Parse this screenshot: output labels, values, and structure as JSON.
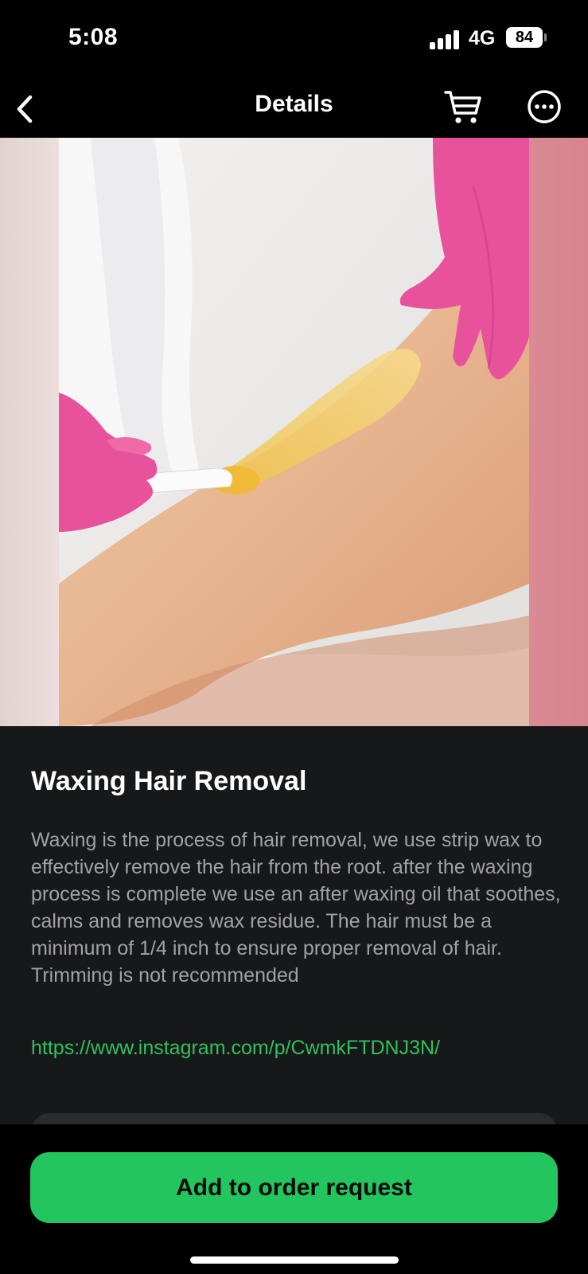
{
  "status_bar": {
    "time": "5:08",
    "network": "4G",
    "battery": "84"
  },
  "nav": {
    "title": "Details",
    "back_icon": "chevron-left-icon",
    "cart_icon": "cart-icon",
    "more_icon": "more-icon"
  },
  "service": {
    "title": "Waxing Hair Removal",
    "description": "Waxing is the process of hair removal, we use strip wax to effectively remove the hair from the root. after the waxing process is complete we use an after waxing oil that soothes, calms and removes wax residue. The hair must be a minimum of 1/4 inch to ensure proper removal of hair. Trimming is not recommended",
    "link": "https://www.instagram.com/p/CwmkFTDNJ3N/"
  },
  "footer": {
    "order_button_label": "Add to order request"
  },
  "colors": {
    "accent": "#22c55e",
    "link": "#2fc15c",
    "background": "#171819",
    "glove": "#e8529c"
  }
}
